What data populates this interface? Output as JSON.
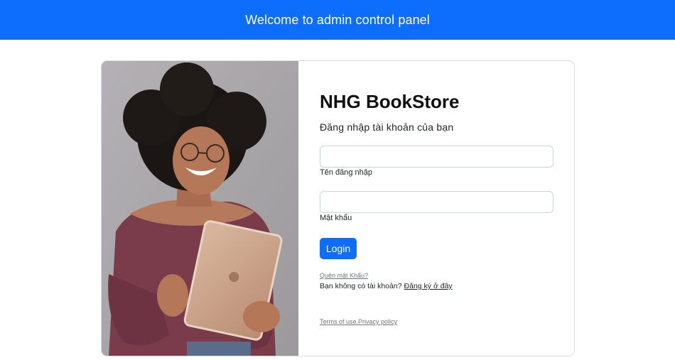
{
  "header": {
    "title": "Welcome to admin control panel"
  },
  "login": {
    "brand": "NHG BookStore",
    "subtitle": "Đăng nhập tài khoản của bạn",
    "username": {
      "value": "",
      "label": "Tên đăng nhập"
    },
    "password": {
      "value": "",
      "label": "Mật khẩu"
    },
    "login_button": "Login",
    "forgot_password": "Quên mật Khẩu?",
    "register_prompt": "Bạn không có tài khoản?",
    "register_link": "Đăng ký ở đây",
    "terms_of_use": "Terms of use.",
    "privacy_policy": "Privacy policy"
  },
  "colors": {
    "primary": "#0d6efd",
    "photo_background": "#a8a6a8"
  }
}
